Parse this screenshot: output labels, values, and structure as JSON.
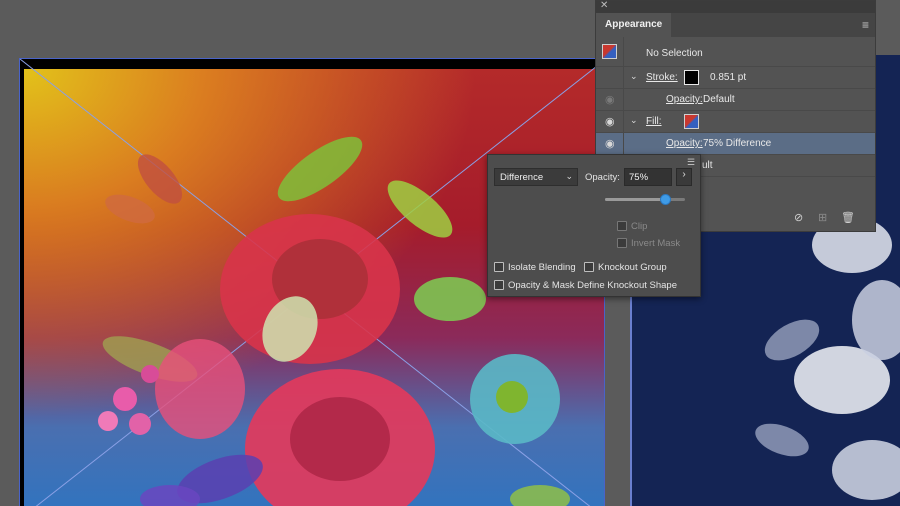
{
  "appearance_panel": {
    "tab_title": "Appearance",
    "selection_label": "No Selection",
    "rows": [
      {
        "label": "Stroke:",
        "value": "0.851 pt"
      },
      {
        "label": "Opacity:",
        "value": "Default"
      },
      {
        "label": "Fill:",
        "value": ""
      },
      {
        "label": "Opacity:",
        "value": "75% Difference"
      },
      {
        "label": "",
        "value": "ult"
      }
    ],
    "icons": {
      "close": "close-icon",
      "menu": "panel-menu-icon",
      "eye": "visibility-eye-icon",
      "clear": "clear-appearance-icon",
      "duplicate": "duplicate-item-icon",
      "delete": "trash-icon"
    }
  },
  "transparency_popup": {
    "blend_mode": "Difference",
    "opacity_label": "Opacity:",
    "opacity_value": "75%",
    "opacity_fraction": 0.75,
    "clip_label": "Clip",
    "invert_mask_label": "Invert Mask",
    "isolate_blending_label": "Isolate Blending",
    "knockout_group_label": "Knockout Group",
    "opacity_mask_label": "Opacity & Mask Define Knockout Shape"
  },
  "colors": {
    "accent": "#3f9be6",
    "selected_row": "#5b6d86",
    "artboard_border": "#4a63c9"
  }
}
